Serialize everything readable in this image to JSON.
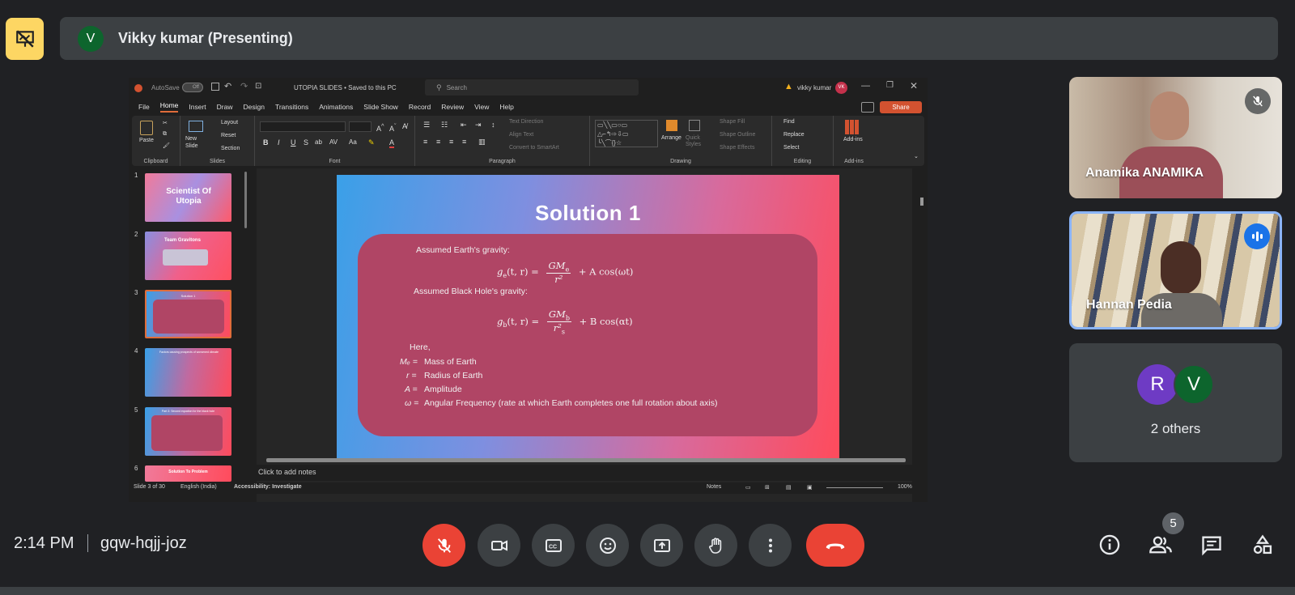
{
  "presenter": {
    "avatar_letter": "V",
    "name": "Vikky kumar (Presenting)"
  },
  "ppt": {
    "autosave": "AutoSave",
    "autosave_state": "Off",
    "doc_title": "UTOPIA SLIDES • Saved to this PC",
    "search_placeholder": "Search",
    "user": "vikky kumar",
    "user_initials": "VK",
    "menu": [
      "File",
      "Home",
      "Insert",
      "Draw",
      "Design",
      "Transitions",
      "Animations",
      "Slide Show",
      "Record",
      "Review",
      "View",
      "Help"
    ],
    "share": "Share",
    "ribbon": {
      "clipboard": "Clipboard",
      "paste": "Paste",
      "slides": "Slides",
      "new_slide": "New Slide",
      "layout": "Layout",
      "reset": "Reset",
      "section": "Section",
      "font": "Font",
      "paragraph": "Paragraph",
      "text_direction": "Text Direction",
      "align_text": "Align Text",
      "convert_smartart": "Convert to SmartArt",
      "drawing": "Drawing",
      "arrange": "Arrange",
      "quick_styles": "Quick Styles",
      "shape_fill": "Shape Fill",
      "shape_outline": "Shape Outline",
      "shape_effects": "Shape Effects",
      "editing": "Editing",
      "find": "Find",
      "replace": "Replace",
      "select": "Select",
      "addins": "Add-ins",
      "addins_btn": "Add-ins"
    },
    "thumbs": [
      {
        "num": "1",
        "title": "Scientist Of Utopia"
      },
      {
        "num": "2",
        "title": "Team Gravitons"
      },
      {
        "num": "3",
        "title": "Solution 1"
      },
      {
        "num": "4",
        "title": "Factors causing prospects of worsened climate"
      },
      {
        "num": "5",
        "title": "Part 3: Second equation for the black hole"
      },
      {
        "num": "6",
        "title": "Solution To Problem"
      }
    ],
    "notes_placeholder": "Click to add notes",
    "status": {
      "slide": "Slide 3 of 30",
      "lang": "English (India)",
      "accessibility": "Accessibility: Investigate",
      "notes": "Notes",
      "zoom": "100%"
    }
  },
  "slide": {
    "title": "Solution 1",
    "earth_label": "Assumed Earth's gravity:",
    "eq1_lhs": "g",
    "eq1_sub": "e",
    "eq1_args": "(t, r) =",
    "eq1_num": "GM",
    "eq1_num_sub": "e",
    "eq1_den": "r²",
    "eq1_tail": "+  A cos(ωt)",
    "bh_label": "Assumed Black Hole's gravity:",
    "eq2_lhs": "g",
    "eq2_sub": "b",
    "eq2_args": "(t, r) =",
    "eq2_num": "GM",
    "eq2_num_sub": "b",
    "eq2_den": "r²",
    "eq2_den_sub": "s",
    "eq2_tail": "+  B cos(αt)",
    "here": "Here,",
    "defs": [
      {
        "sym": "Mₑ =",
        "text": "Mass of Earth"
      },
      {
        "sym": "r =",
        "text": "Radius of Earth"
      },
      {
        "sym": "A =",
        "text": "Amplitude"
      },
      {
        "sym": "ω =",
        "text": "Angular Frequency (rate at which Earth completes one full rotation about axis)"
      }
    ]
  },
  "participants": {
    "p1": "Anamika ANAMIKA",
    "p2": "Hannan Pedia",
    "others_letters": [
      "R",
      "V"
    ],
    "others_label": "2 others"
  },
  "bottom": {
    "time": "2:14 PM",
    "meeting_code": "gqw-hqjj-joz",
    "people_count": "5"
  },
  "colors": {
    "accent_yellow": "#fdd663",
    "end_call_red": "#ea4335",
    "active_blue": "#8ab4f8"
  }
}
